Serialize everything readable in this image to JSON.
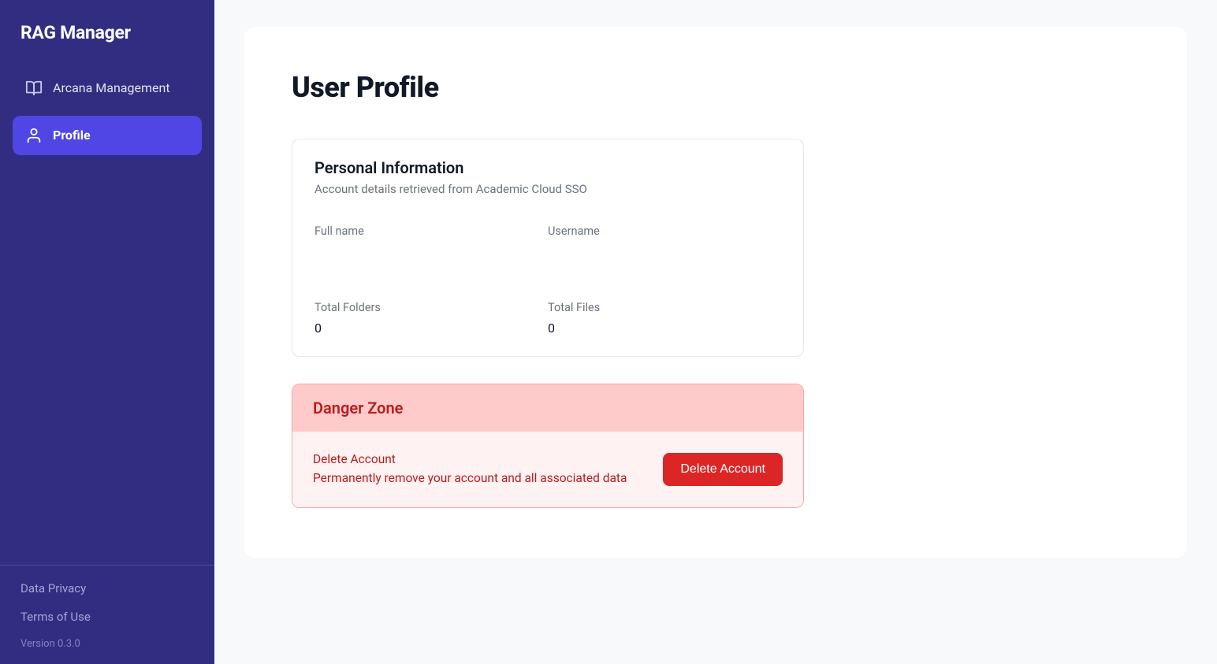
{
  "app": {
    "title": "RAG Manager"
  },
  "sidebar": {
    "items": [
      {
        "label": "Arcana Management"
      },
      {
        "label": "Profile"
      }
    ],
    "footer": {
      "privacy": "Data Privacy",
      "terms": "Terms of Use",
      "version": "Version 0.3.0"
    }
  },
  "page": {
    "title": "User Profile",
    "personal": {
      "heading": "Personal Information",
      "sub": "Account details retrieved from Academic Cloud SSO",
      "full_name_label": "Full name",
      "full_name_value": "",
      "username_label": "Username",
      "username_value": "",
      "folders_label": "Total Folders",
      "folders_value": "0",
      "files_label": "Total Files",
      "files_value": "0"
    },
    "danger": {
      "heading": "Danger Zone",
      "row_title": "Delete Account",
      "row_sub": "Permanently remove your account and all associated data",
      "button": "Delete Account"
    }
  },
  "colors": {
    "sidebar_bg": "#312e81",
    "accent": "#4f46e5",
    "danger": "#dc2626"
  }
}
